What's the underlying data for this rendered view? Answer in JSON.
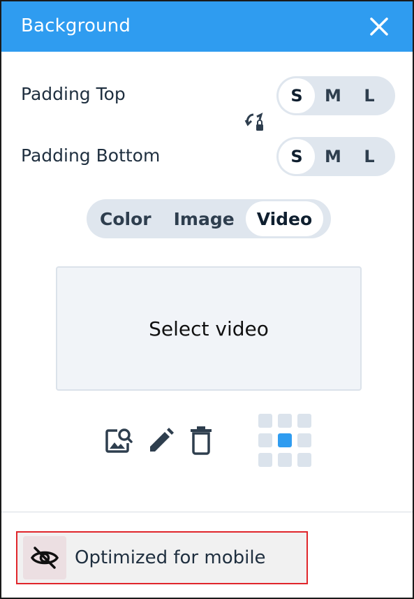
{
  "header": {
    "title": "Background",
    "close_icon": "close-icon"
  },
  "padding_top": {
    "label": "Padding Top",
    "options": [
      "S",
      "M",
      "L"
    ],
    "selected": "S"
  },
  "padding_bottom": {
    "label": "Padding Bottom",
    "options": [
      "S",
      "M",
      "L"
    ],
    "selected": "S"
  },
  "sync_icon": "sync-lock-icon",
  "tabs": {
    "items": [
      "Color",
      "Image",
      "Video"
    ],
    "selected": "Video"
  },
  "video": {
    "select_label": "Select video"
  },
  "tools": [
    "image-search-icon",
    "pencil-icon",
    "trash-icon"
  ],
  "position_grid": {
    "rows": 3,
    "cols": 3,
    "selected_index": 4
  },
  "mobile": {
    "label": "Optimized for mobile",
    "icon": "eye-off-icon"
  },
  "colors": {
    "accent": "#2f9cf0",
    "segment_bg": "#dfe6ee",
    "highlight_border": "#e0262b"
  }
}
